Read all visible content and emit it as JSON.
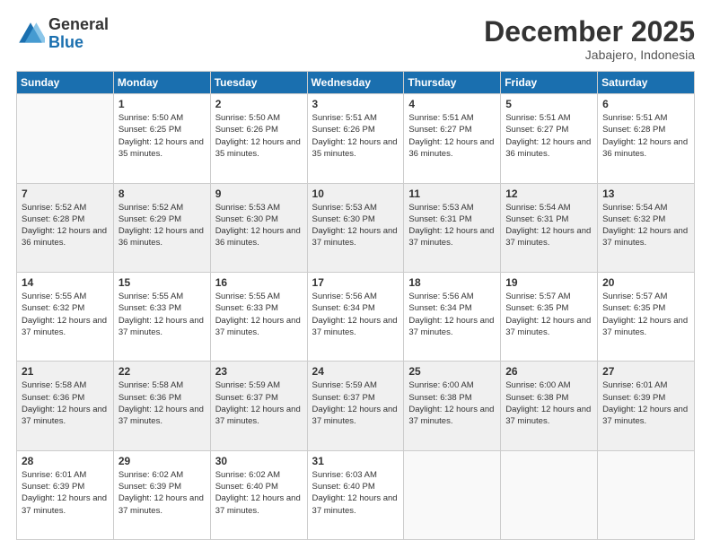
{
  "header": {
    "logo": {
      "general": "General",
      "blue": "Blue"
    },
    "title": "December 2025",
    "location": "Jabajero, Indonesia"
  },
  "days_of_week": [
    "Sunday",
    "Monday",
    "Tuesday",
    "Wednesday",
    "Thursday",
    "Friday",
    "Saturday"
  ],
  "weeks": [
    [
      {
        "day": "",
        "sunrise": "",
        "sunset": "",
        "daylight": "",
        "empty": true
      },
      {
        "day": "1",
        "sunrise": "Sunrise: 5:50 AM",
        "sunset": "Sunset: 6:25 PM",
        "daylight": "Daylight: 12 hours and 35 minutes."
      },
      {
        "day": "2",
        "sunrise": "Sunrise: 5:50 AM",
        "sunset": "Sunset: 6:26 PM",
        "daylight": "Daylight: 12 hours and 35 minutes."
      },
      {
        "day": "3",
        "sunrise": "Sunrise: 5:51 AM",
        "sunset": "Sunset: 6:26 PM",
        "daylight": "Daylight: 12 hours and 35 minutes."
      },
      {
        "day": "4",
        "sunrise": "Sunrise: 5:51 AM",
        "sunset": "Sunset: 6:27 PM",
        "daylight": "Daylight: 12 hours and 36 minutes."
      },
      {
        "day": "5",
        "sunrise": "Sunrise: 5:51 AM",
        "sunset": "Sunset: 6:27 PM",
        "daylight": "Daylight: 12 hours and 36 minutes."
      },
      {
        "day": "6",
        "sunrise": "Sunrise: 5:51 AM",
        "sunset": "Sunset: 6:28 PM",
        "daylight": "Daylight: 12 hours and 36 minutes."
      }
    ],
    [
      {
        "day": "7",
        "sunrise": "Sunrise: 5:52 AM",
        "sunset": "Sunset: 6:28 PM",
        "daylight": "Daylight: 12 hours and 36 minutes."
      },
      {
        "day": "8",
        "sunrise": "Sunrise: 5:52 AM",
        "sunset": "Sunset: 6:29 PM",
        "daylight": "Daylight: 12 hours and 36 minutes."
      },
      {
        "day": "9",
        "sunrise": "Sunrise: 5:53 AM",
        "sunset": "Sunset: 6:30 PM",
        "daylight": "Daylight: 12 hours and 36 minutes."
      },
      {
        "day": "10",
        "sunrise": "Sunrise: 5:53 AM",
        "sunset": "Sunset: 6:30 PM",
        "daylight": "Daylight: 12 hours and 37 minutes."
      },
      {
        "day": "11",
        "sunrise": "Sunrise: 5:53 AM",
        "sunset": "Sunset: 6:31 PM",
        "daylight": "Daylight: 12 hours and 37 minutes."
      },
      {
        "day": "12",
        "sunrise": "Sunrise: 5:54 AM",
        "sunset": "Sunset: 6:31 PM",
        "daylight": "Daylight: 12 hours and 37 minutes."
      },
      {
        "day": "13",
        "sunrise": "Sunrise: 5:54 AM",
        "sunset": "Sunset: 6:32 PM",
        "daylight": "Daylight: 12 hours and 37 minutes."
      }
    ],
    [
      {
        "day": "14",
        "sunrise": "Sunrise: 5:55 AM",
        "sunset": "Sunset: 6:32 PM",
        "daylight": "Daylight: 12 hours and 37 minutes."
      },
      {
        "day": "15",
        "sunrise": "Sunrise: 5:55 AM",
        "sunset": "Sunset: 6:33 PM",
        "daylight": "Daylight: 12 hours and 37 minutes."
      },
      {
        "day": "16",
        "sunrise": "Sunrise: 5:55 AM",
        "sunset": "Sunset: 6:33 PM",
        "daylight": "Daylight: 12 hours and 37 minutes."
      },
      {
        "day": "17",
        "sunrise": "Sunrise: 5:56 AM",
        "sunset": "Sunset: 6:34 PM",
        "daylight": "Daylight: 12 hours and 37 minutes."
      },
      {
        "day": "18",
        "sunrise": "Sunrise: 5:56 AM",
        "sunset": "Sunset: 6:34 PM",
        "daylight": "Daylight: 12 hours and 37 minutes."
      },
      {
        "day": "19",
        "sunrise": "Sunrise: 5:57 AM",
        "sunset": "Sunset: 6:35 PM",
        "daylight": "Daylight: 12 hours and 37 minutes."
      },
      {
        "day": "20",
        "sunrise": "Sunrise: 5:57 AM",
        "sunset": "Sunset: 6:35 PM",
        "daylight": "Daylight: 12 hours and 37 minutes."
      }
    ],
    [
      {
        "day": "21",
        "sunrise": "Sunrise: 5:58 AM",
        "sunset": "Sunset: 6:36 PM",
        "daylight": "Daylight: 12 hours and 37 minutes."
      },
      {
        "day": "22",
        "sunrise": "Sunrise: 5:58 AM",
        "sunset": "Sunset: 6:36 PM",
        "daylight": "Daylight: 12 hours and 37 minutes."
      },
      {
        "day": "23",
        "sunrise": "Sunrise: 5:59 AM",
        "sunset": "Sunset: 6:37 PM",
        "daylight": "Daylight: 12 hours and 37 minutes."
      },
      {
        "day": "24",
        "sunrise": "Sunrise: 5:59 AM",
        "sunset": "Sunset: 6:37 PM",
        "daylight": "Daylight: 12 hours and 37 minutes."
      },
      {
        "day": "25",
        "sunrise": "Sunrise: 6:00 AM",
        "sunset": "Sunset: 6:38 PM",
        "daylight": "Daylight: 12 hours and 37 minutes."
      },
      {
        "day": "26",
        "sunrise": "Sunrise: 6:00 AM",
        "sunset": "Sunset: 6:38 PM",
        "daylight": "Daylight: 12 hours and 37 minutes."
      },
      {
        "day": "27",
        "sunrise": "Sunrise: 6:01 AM",
        "sunset": "Sunset: 6:39 PM",
        "daylight": "Daylight: 12 hours and 37 minutes."
      }
    ],
    [
      {
        "day": "28",
        "sunrise": "Sunrise: 6:01 AM",
        "sunset": "Sunset: 6:39 PM",
        "daylight": "Daylight: 12 hours and 37 minutes."
      },
      {
        "day": "29",
        "sunrise": "Sunrise: 6:02 AM",
        "sunset": "Sunset: 6:39 PM",
        "daylight": "Daylight: 12 hours and 37 minutes."
      },
      {
        "day": "30",
        "sunrise": "Sunrise: 6:02 AM",
        "sunset": "Sunset: 6:40 PM",
        "daylight": "Daylight: 12 hours and 37 minutes."
      },
      {
        "day": "31",
        "sunrise": "Sunrise: 6:03 AM",
        "sunset": "Sunset: 6:40 PM",
        "daylight": "Daylight: 12 hours and 37 minutes."
      },
      {
        "day": "",
        "sunrise": "",
        "sunset": "",
        "daylight": "",
        "empty": true
      },
      {
        "day": "",
        "sunrise": "",
        "sunset": "",
        "daylight": "",
        "empty": true
      },
      {
        "day": "",
        "sunrise": "",
        "sunset": "",
        "daylight": "",
        "empty": true
      }
    ]
  ]
}
